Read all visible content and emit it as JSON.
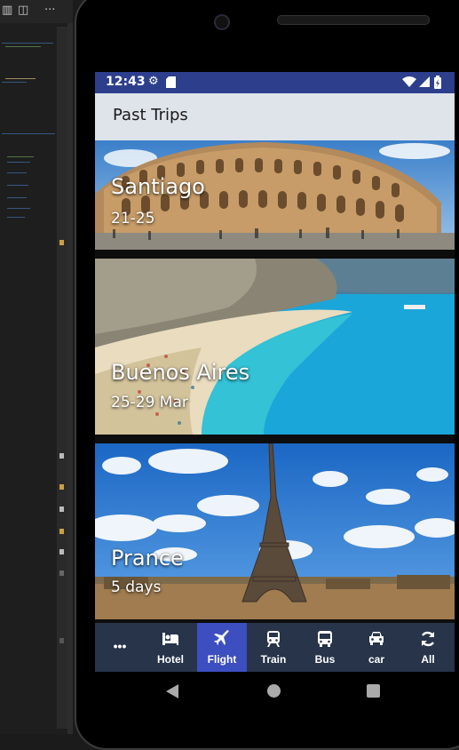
{
  "status_bar": {
    "time": "12:43"
  },
  "app_bar": {
    "title": "Past Trips"
  },
  "trips": [
    {
      "city": "Santiago",
      "dates": "21-25"
    },
    {
      "city": "Buenos Aires",
      "dates": "25-29 Mar"
    },
    {
      "city": "Prance",
      "dates": "5 days"
    }
  ],
  "bottom_nav": {
    "more": "•••",
    "items": [
      {
        "label": "Hotel",
        "icon": "bed-icon"
      },
      {
        "label": "Flight",
        "icon": "airplane-icon",
        "active": true
      },
      {
        "label": "Train",
        "icon": "train-icon"
      },
      {
        "label": "Bus",
        "icon": "bus-icon"
      },
      {
        "label": "car",
        "icon": "car-icon"
      },
      {
        "label": "All",
        "icon": "sync-icon"
      }
    ]
  },
  "colors": {
    "status_bar": "#2c3e8c",
    "app_bar": "#dfe3ea",
    "nav_bg": "#273449",
    "nav_active": "#3c4ec0"
  }
}
